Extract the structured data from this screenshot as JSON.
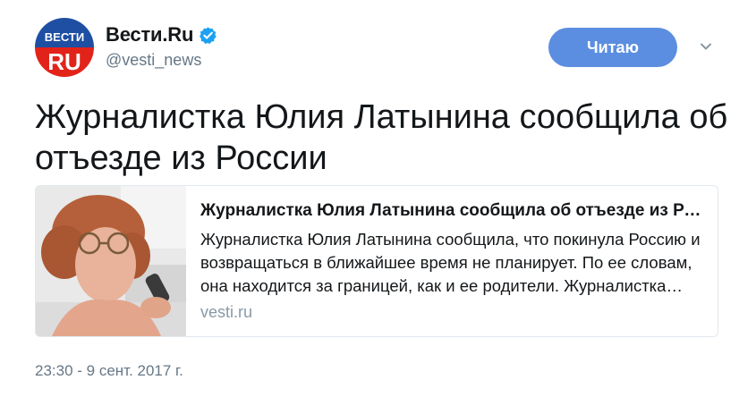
{
  "account": {
    "display_name": "Вести.Ru",
    "handle": "@vesti_news",
    "avatar_top_text": "ВЕСТИ",
    "avatar_bottom_text": "RU",
    "verified": true
  },
  "follow_button": {
    "label": "Читаю"
  },
  "tweet": {
    "text": "Журналистка Юлия Латынина сообщила об отъезде из России",
    "timestamp": "23:30 - 9 сент. 2017 г."
  },
  "card": {
    "title": "Журналистка Юлия Латынина сообщила об отъезде из России",
    "description": "Журналистка Юлия Латынина сообщила, что покинула Россию и возвращаться в ближайшее время не планирует. По ее словам, она находится за границей, как и ее родители. Журналистка рассказала о своем решении.",
    "domain": "vesti.ru"
  },
  "colors": {
    "accent": "#5b8ee0",
    "verified": "#1da1f2",
    "muted_text": "#657786",
    "border": "#e1e8ed",
    "avatar_blue": "#1e4fa3",
    "avatar_red": "#e2231a"
  },
  "icons": {
    "verified": "verified-badge-icon",
    "menu": "chevron-down-icon"
  }
}
